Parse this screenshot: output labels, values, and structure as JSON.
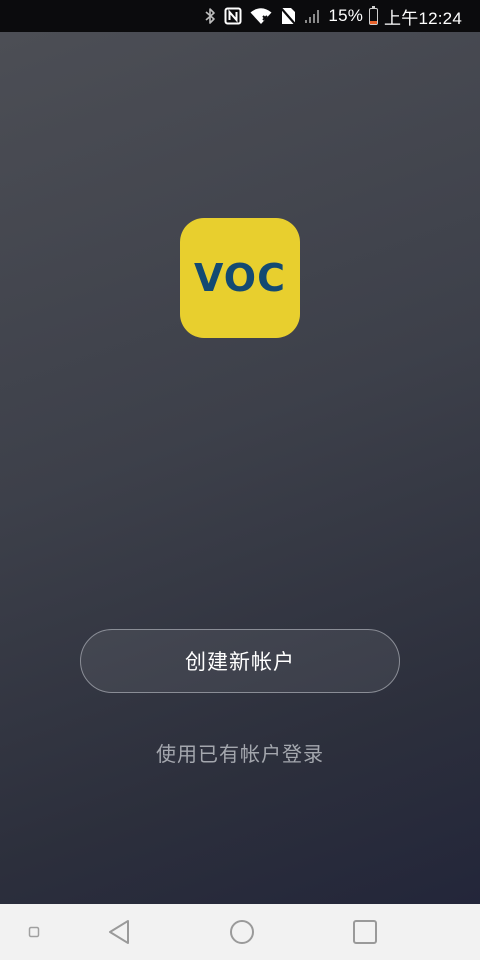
{
  "status_bar": {
    "battery_percent": "15%",
    "battery_level": 0.15,
    "time": "上午12:24",
    "icons": [
      "bluetooth-icon",
      "nfc-icon",
      "wifi-icon",
      "no-sim-icon",
      "signal-icon",
      "battery-icon"
    ],
    "battery_color": "#e8632c"
  },
  "logo": {
    "text": "VOC",
    "background_color": "#e8cf2e",
    "text_color": "#134a72"
  },
  "actions": {
    "create_account_label": "创建新帐户",
    "login_label": "使用已有帐户登录"
  },
  "nav_bar": {
    "buttons": [
      "extra-dot-icon",
      "back-icon",
      "home-icon",
      "recents-icon"
    ]
  }
}
